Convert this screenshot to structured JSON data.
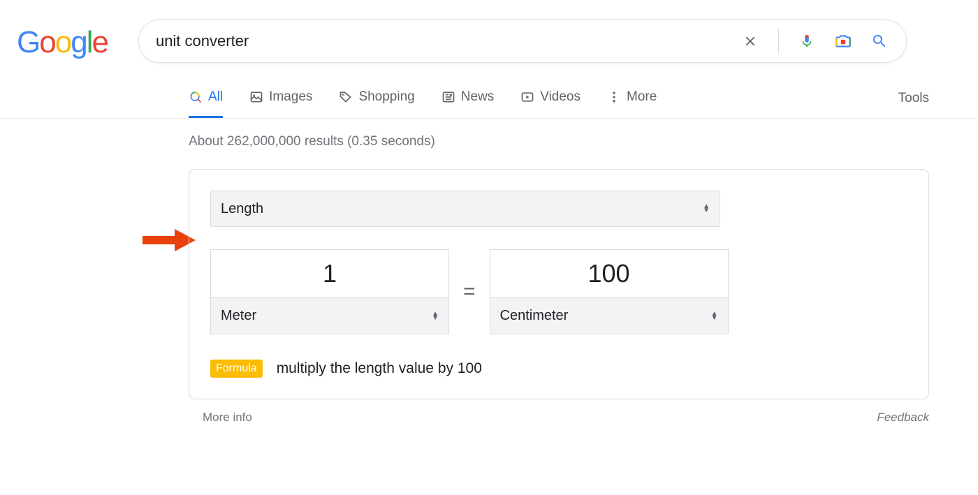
{
  "search": {
    "query": "unit converter"
  },
  "tabs": {
    "all": "All",
    "images": "Images",
    "shopping": "Shopping",
    "news": "News",
    "videos": "Videos",
    "more": "More",
    "tools": "Tools"
  },
  "results": {
    "stats": "About 262,000,000 results (0.35 seconds)"
  },
  "converter": {
    "category": "Length",
    "from_value": "1",
    "from_unit": "Meter",
    "to_value": "100",
    "to_unit": "Centimeter",
    "equals": "=",
    "formula_label": "Formula",
    "formula_text": "multiply the length value by 100"
  },
  "footer": {
    "more_info": "More info",
    "feedback": "Feedback"
  }
}
